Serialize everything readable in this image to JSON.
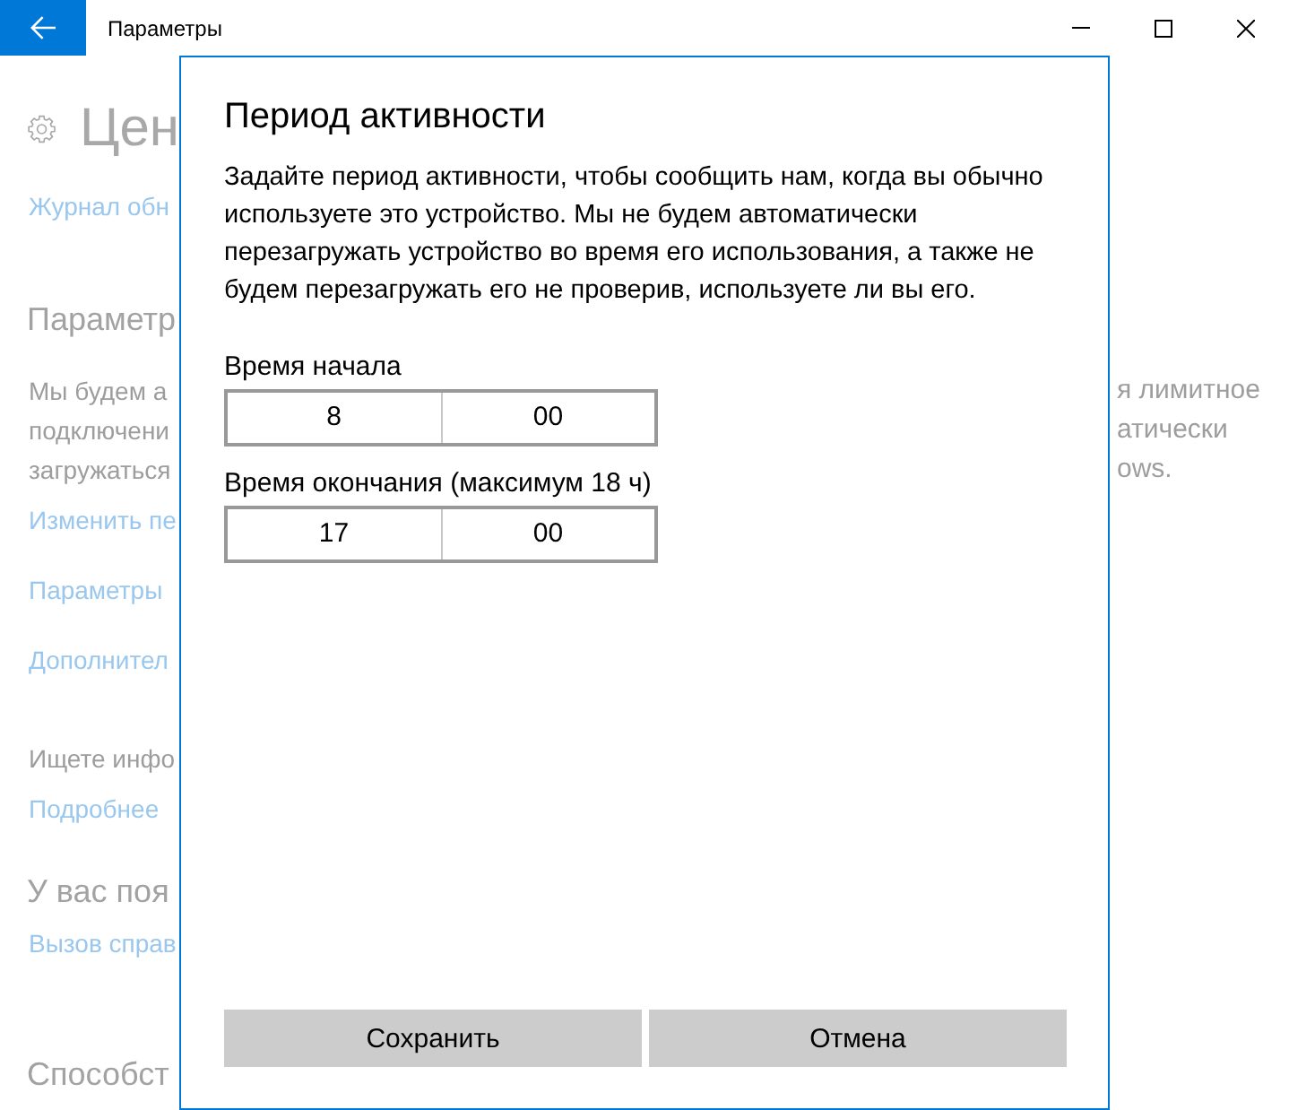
{
  "window": {
    "title": "Параметры"
  },
  "page": {
    "groups": [
      {
        "items": [
          {
            "kind": "heading",
            "text": "Цен"
          },
          {
            "kind": "link",
            "text": "Журнал обн"
          }
        ]
      },
      {
        "items": [
          {
            "kind": "subheading",
            "text": "Параметр"
          },
          {
            "kind": "paragraph",
            "lines": [
              "Мы будем а",
              "подключени",
              "загружаться"
            ]
          },
          {
            "kind": "link",
            "text": "Изменить пе"
          },
          {
            "kind": "link",
            "text": "Параметры"
          },
          {
            "kind": "link",
            "text": "Дополнител"
          }
        ]
      },
      {
        "items": [
          {
            "kind": "paragraph",
            "lines": [
              "Ищете инфо"
            ]
          },
          {
            "kind": "link",
            "text": "Подробнее"
          }
        ]
      },
      {
        "items": [
          {
            "kind": "subheading",
            "text": "У вас поя"
          },
          {
            "kind": "link",
            "text": "Вызов справ"
          }
        ]
      },
      {
        "items": [
          {
            "kind": "subheading",
            "text": "Способст"
          }
        ]
      }
    ],
    "right_fragment": [
      "я лимитное",
      "атически",
      "ows."
    ]
  },
  "dialog": {
    "title": "Период активности",
    "description": "Задайте период активности, чтобы сообщить нам, когда вы обычно используете это устройство. Мы не будем автоматически перезагружать устройство во время его использования, а также не будем перезагружать его не проверив, используете ли вы его.",
    "time_fields": [
      {
        "label": "Время начала",
        "hour": "8",
        "minute": "00"
      },
      {
        "label": "Время окончания (максимум 18 ч)",
        "hour": "17",
        "minute": "00"
      }
    ],
    "buttons": [
      "Сохранить",
      "Отмена"
    ]
  }
}
